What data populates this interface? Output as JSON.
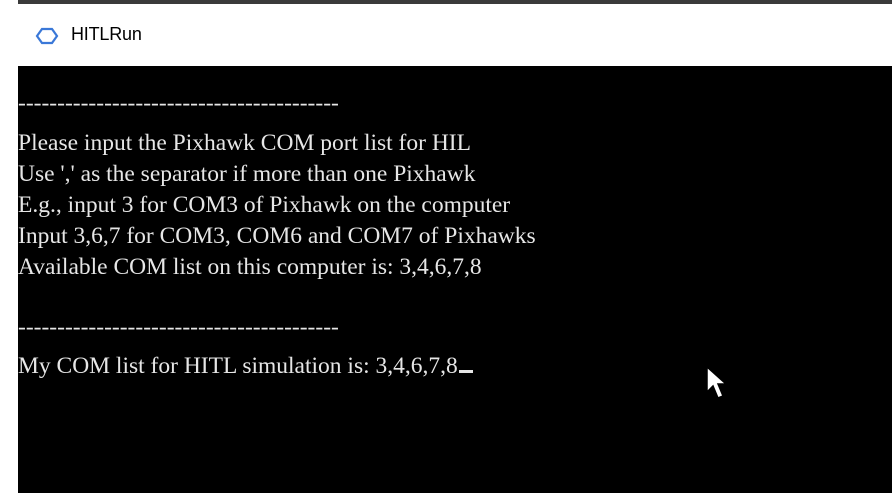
{
  "window": {
    "title": "HITLRun",
    "icon": "app-icon"
  },
  "console": {
    "separator_1": "-----------------------------------------",
    "lines": [
      "Please input the Pixhawk COM port list for HIL",
      "Use ',' as the separator if more than one Pixhawk",
      "E.g., input 3 for COM3 of Pixhawk on the computer",
      "Input 3,6,7 for COM3, COM6 and COM7 of Pixhawks",
      "Available COM list on this computer is: 3,4,6,7,8"
    ],
    "separator_2": "-----------------------------------------",
    "prompt": "My COM list for HITL simulation is: 3,4,6,7,8"
  },
  "colors": {
    "console_background": "#000000",
    "console_text": "#e6e6e6",
    "titlebar_background": "#ffffff",
    "icon_blue": "#3a78d8"
  },
  "icons": {
    "app": "hexagon-app-icon",
    "pointer": "mouse-pointer-icon"
  }
}
